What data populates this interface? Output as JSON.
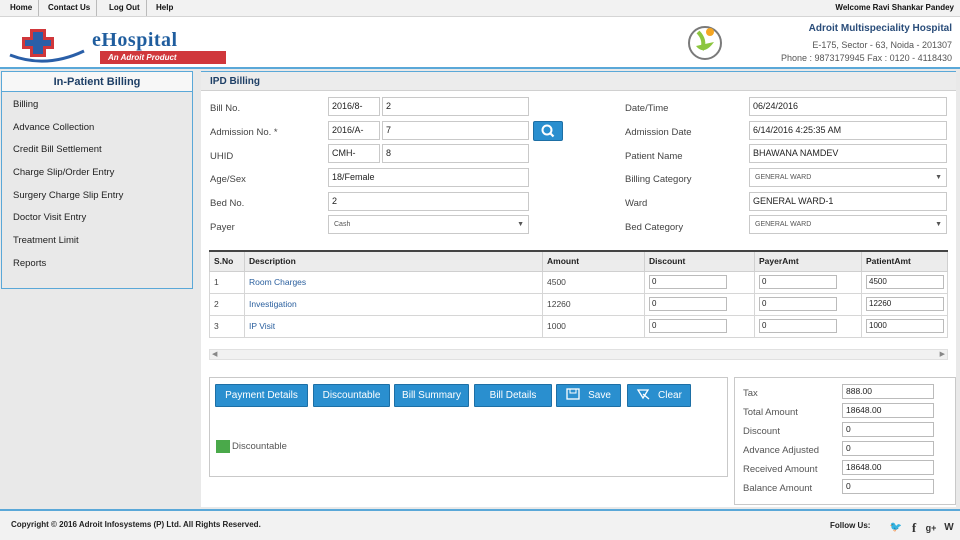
{
  "topnav": {
    "home": "Home",
    "contact": "Contact Us",
    "logout": "Log Out",
    "help": "Help",
    "welcome": "Welcome Ravi Shankar Pandey"
  },
  "header": {
    "logo_text": "eHospital",
    "logo_tagline": "An Adroit Product",
    "hospital_name": "Adroit Multispeciality Hospital",
    "address": "E-175, Sector - 63, Noida - 201307",
    "phone": "Phone : 9873179945 Fax : 0120 - 4118430"
  },
  "sidebar": {
    "title": "In-Patient Billing",
    "items": [
      {
        "label": "Billing"
      },
      {
        "label": "Advance Collection"
      },
      {
        "label": "Credit Bill Settlement"
      },
      {
        "label": "Charge Slip/Order Entry"
      },
      {
        "label": "Surgery Charge Slip Entry"
      },
      {
        "label": "Doctor Visit Entry"
      },
      {
        "label": "Treatment Limit"
      },
      {
        "label": "Reports"
      }
    ]
  },
  "main": {
    "title": "IPD Billing",
    "form": {
      "bill_no_label": "Bill No.",
      "bill_no_prefix": "2016/8-",
      "bill_no_value": "2",
      "admission_no_label": "Admission No. *",
      "admission_no_prefix": "2016/A-",
      "admission_no_value": "7",
      "uhid_label": "UHID",
      "uhid_prefix": "CMH-",
      "uhid_value": "8",
      "age_sex_label": "Age/Sex",
      "age_sex_value": "18/Female",
      "bed_no_label": "Bed No.",
      "bed_no_value": "2",
      "payer_label": "Payer",
      "payer_value": "Cash",
      "date_time_label": "Date/Time",
      "date_time_value": "06/24/2016",
      "admission_date_label": "Admission Date",
      "admission_date_value": "6/14/2016 4:25:35 AM",
      "patient_name_label": "Patient Name",
      "patient_name_value": "BHAWANA NAMDEV",
      "billing_category_label": "Billing Category",
      "billing_category_value": "GENERAL WARD",
      "ward_label": "Ward",
      "ward_value": "GENERAL WARD-1",
      "bed_category_label": "Bed Category",
      "bed_category_value": "GENERAL WARD"
    },
    "table": {
      "headers": [
        "S.No",
        "Description",
        "Amount",
        "Discount",
        "PayerAmt",
        "PatientAmt"
      ],
      "rows": [
        {
          "sno": "1",
          "desc": "Room Charges",
          "amount": "4500",
          "discount": "0",
          "payer": "0",
          "patient": "4500"
        },
        {
          "sno": "2",
          "desc": "Investigation",
          "amount": "12260",
          "discount": "0",
          "payer": "0",
          "patient": "12260"
        },
        {
          "sno": "3",
          "desc": "IP Visit",
          "amount": "1000",
          "discount": "0",
          "payer": "0",
          "patient": "1000"
        }
      ]
    },
    "buttons": {
      "payment_details": "Payment Details",
      "discountable": "Discountable",
      "bill_summary": "Bill Summary",
      "bill_details": "Bill Details",
      "save": "Save",
      "clear": "Clear"
    },
    "legend": {
      "label": "Discountable",
      "color": "#4aa94a"
    },
    "totals": {
      "tax_label": "Tax",
      "tax_value": "888.00",
      "total_amount_label": "Total Amount",
      "total_amount_value": "18648.00",
      "discount_label": "Discount",
      "discount_value": "0",
      "advance_adjusted_label": "Advance Adjusted",
      "advance_adjusted_value": "0",
      "received_amount_label": "Received Amount",
      "received_amount_value": "18648.00",
      "balance_amount_label": "Balance Amount",
      "balance_amount_value": "0"
    }
  },
  "footer": {
    "copyright": "Copyright © 2016 Adroit Infosystems (P) Ltd. All Rights Reserved.",
    "follow": "Follow Us:",
    "social": [
      "twitter-icon",
      "facebook-icon",
      "googleplus-icon",
      "wordpress-icon"
    ]
  },
  "colors": {
    "accent": "#2a8fcf",
    "border": "#5aa8d8",
    "title": "#1e3f66"
  }
}
